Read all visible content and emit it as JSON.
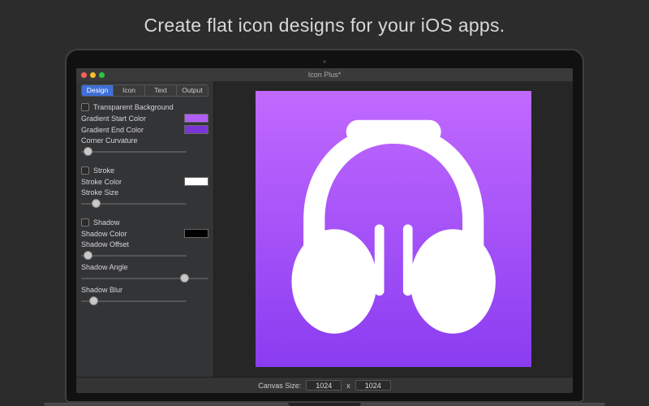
{
  "headline": "Create flat icon designs for your iOS apps.",
  "window": {
    "title": "Icon Plus*"
  },
  "tabs": {
    "design": "Design",
    "icon": "Icon",
    "text": "Text",
    "output": "Output",
    "active": "Design"
  },
  "panel": {
    "transparent_bg_label": "Transparent Background",
    "gradient_start_label": "Gradient Start Color",
    "gradient_start_color": "#b15ef5",
    "gradient_end_label": "Gradient End Color",
    "gradient_end_color": "#7a35d6",
    "corner_curvature_label": "Corner Curvature",
    "corner_curvature_knob": 2,
    "stroke_label": "Stroke",
    "stroke_color_label": "Stroke Color",
    "stroke_color": "#ffffff",
    "stroke_size_label": "Stroke Size",
    "stroke_size_knob": 10,
    "shadow_label": "Shadow",
    "shadow_color_label": "Shadow Color",
    "shadow_color": "#000000",
    "shadow_offset_label": "Shadow Offset",
    "shadow_offset_knob": 2,
    "shadow_angle_label": "Shadow Angle",
    "shadow_angle_knob": 78,
    "shadow_blur_label": "Shadow Blur",
    "shadow_blur_knob": 8
  },
  "footer": {
    "canvas_size_label": "Canvas Size:",
    "width": "1024",
    "by": "x",
    "height": "1024"
  }
}
